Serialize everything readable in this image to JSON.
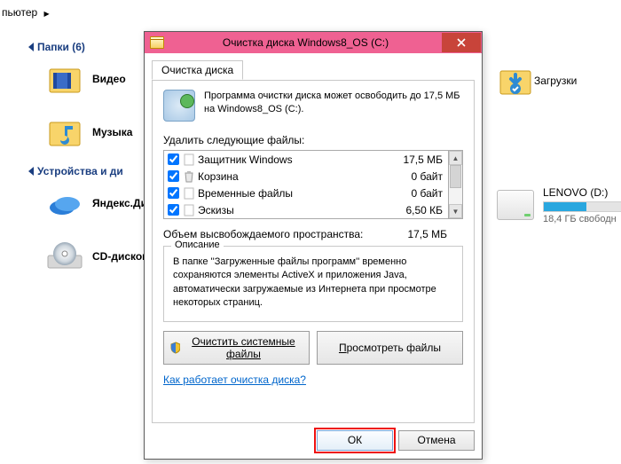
{
  "breadcrumb": {
    "item0": "пьютер"
  },
  "sections": {
    "folders": {
      "title": "Папки (6)"
    },
    "devices": {
      "title": "Устройства и ди"
    }
  },
  "explorerItems": {
    "video": "Видео",
    "music": "Музыка",
    "yadisk": "Яндекс.Ди",
    "cddrive": "CD-дисков",
    "downloads": "Загрузки",
    "lenovo_name": "LENOVO (D:)",
    "lenovo_free": "18,4 ГБ свободн"
  },
  "dialog": {
    "title": "Очистка диска Windows8_OS (C:)",
    "tab": "Очистка диска",
    "headerText": "Программа очистки диска может освободить до 17,5 МБ на Windows8_OS (С:).",
    "deleteLabel": "Удалить следующие файлы:",
    "rows": [
      {
        "name": "Защитник Windows",
        "size": "17,5 МБ",
        "checked": true
      },
      {
        "name": "Корзина",
        "size": "0 байт",
        "checked": true
      },
      {
        "name": "Временные файлы",
        "size": "0 байт",
        "checked": true
      },
      {
        "name": "Эскизы",
        "size": "6,50 КБ",
        "checked": true
      }
    ],
    "totalLabel": "Объем высвобождаемого пространства:",
    "totalValue": "17,5 МБ",
    "descLegend": "Описание",
    "descText": "В папке ''Загруженные файлы программ'' временно сохраняются элементы ActiveX и приложения Java, автоматически загружаемые из Интернета при просмотре некоторых страниц.",
    "btnSystem": "Очистить системные файлы",
    "btnView": "Просмотреть файлы",
    "helpLink": "Как работает очистка диска?",
    "ok": "ОК",
    "cancel": "Отмена"
  },
  "icons": {
    "close": "close-icon",
    "shield": "shield-icon"
  }
}
